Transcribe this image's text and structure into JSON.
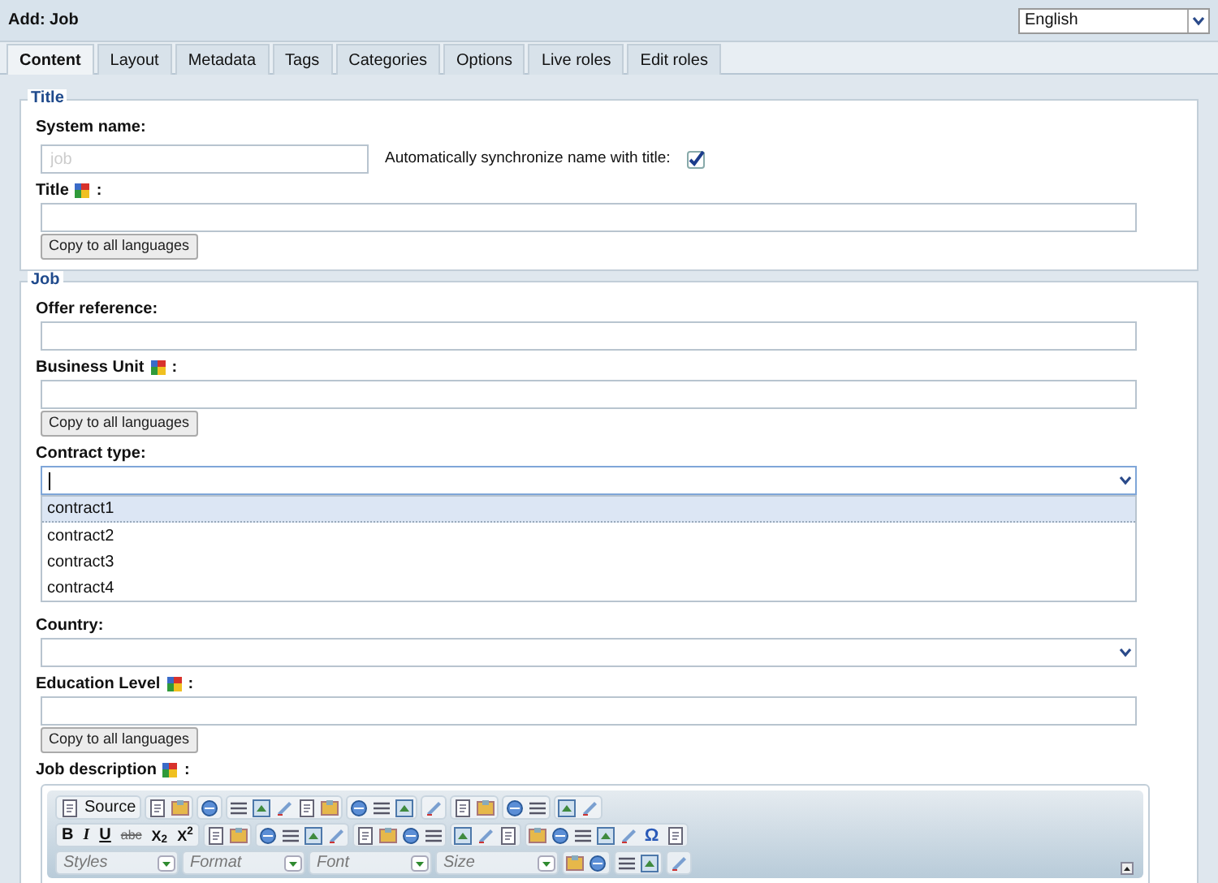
{
  "header": {
    "title": "Add: Job",
    "language": "English"
  },
  "tabs": [
    {
      "label": "Content",
      "selected": true
    },
    {
      "label": "Layout",
      "selected": false
    },
    {
      "label": "Metadata",
      "selected": false
    },
    {
      "label": "Tags",
      "selected": false
    },
    {
      "label": "Categories",
      "selected": false
    },
    {
      "label": "Options",
      "selected": false
    },
    {
      "label": "Live roles",
      "selected": false
    },
    {
      "label": "Edit roles",
      "selected": false
    }
  ],
  "title_section": {
    "legend": "Title",
    "system_name_label": "System name:",
    "system_name_placeholder": "job",
    "sync_label": "Automatically synchronize name with title:",
    "sync_checked": true,
    "title_label": "Title",
    "title_translatable": true,
    "title_colon": ":",
    "copy_button": "Copy to all languages"
  },
  "job_section": {
    "legend": "Job",
    "fields": [
      {
        "kind": "text",
        "label": "Offer reference:",
        "translatable": false
      },
      {
        "kind": "text",
        "label": "Business Unit",
        "translatable": true,
        "colon": ":",
        "copy_button": "Copy to all languages"
      },
      {
        "kind": "combo",
        "label": "Contract type:",
        "translatable": false,
        "expanded": true,
        "options": [
          {
            "label": "contract1",
            "selected": true
          },
          {
            "label": "contract2",
            "selected": false
          },
          {
            "label": "contract3",
            "selected": false
          },
          {
            "label": "contract4",
            "selected": false
          }
        ]
      },
      {
        "kind": "select",
        "label": "Country:",
        "translatable": false
      },
      {
        "kind": "text",
        "label": "Education Level",
        "translatable": true,
        "colon": ":",
        "copy_button": "Copy to all languages"
      },
      {
        "kind": "editor",
        "label": "Job description",
        "translatable": true,
        "colon": ":"
      }
    ]
  },
  "editor": {
    "toolbar_rows": [
      [
        [
          {
            "kind": "source",
            "label": "Source"
          }
        ],
        [
          {
            "kind": "icon"
          },
          {
            "kind": "icon"
          }
        ],
        [
          {
            "kind": "icon"
          }
        ],
        [
          {
            "kind": "icon"
          },
          {
            "kind": "icon"
          },
          {
            "kind": "icon"
          },
          {
            "kind": "icon"
          },
          {
            "kind": "icon"
          }
        ],
        [
          {
            "kind": "icon"
          },
          {
            "kind": "icon"
          },
          {
            "kind": "icon"
          }
        ],
        [
          {
            "kind": "icon"
          }
        ],
        [
          {
            "kind": "icon"
          },
          {
            "kind": "icon"
          }
        ],
        [
          {
            "kind": "icon"
          },
          {
            "kind": "icon"
          }
        ],
        [
          {
            "kind": "icon"
          },
          {
            "kind": "icon"
          }
        ]
      ],
      [
        [
          {
            "kind": "bold",
            "label": "B"
          },
          {
            "kind": "italic",
            "label": "I"
          },
          {
            "kind": "underline",
            "label": "U"
          },
          {
            "kind": "strike",
            "label": "abc"
          },
          {
            "kind": "script",
            "label": "X$_{2}$"
          },
          {
            "kind": "script",
            "label": "X$^{2}$"
          }
        ],
        [
          {
            "kind": "icon"
          },
          {
            "kind": "icon"
          }
        ],
        [
          {
            "kind": "icon"
          },
          {
            "kind": "icon"
          },
          {
            "kind": "icon"
          },
          {
            "kind": "icon"
          }
        ],
        [
          {
            "kind": "icon"
          },
          {
            "kind": "icon"
          },
          {
            "kind": "icon"
          },
          {
            "kind": "icon"
          }
        ],
        [
          {
            "kind": "icon"
          },
          {
            "kind": "icon"
          },
          {
            "kind": "icon"
          }
        ],
        [
          {
            "kind": "icon"
          },
          {
            "kind": "icon"
          },
          {
            "kind": "icon"
          },
          {
            "kind": "icon"
          },
          {
            "kind": "icon"
          },
          {
            "kind": "symbol",
            "label": "Ω"
          },
          {
            "kind": "icon"
          }
        ]
      ],
      [
        [
          {
            "kind": "combo",
            "label": "Styles"
          }
        ],
        [
          {
            "kind": "combo",
            "label": "Format"
          }
        ],
        [
          {
            "kind": "combo",
            "label": "Font"
          }
        ],
        [
          {
            "kind": "combo",
            "label": "Size"
          }
        ],
        [
          {
            "kind": "icon"
          },
          {
            "kind": "icon"
          }
        ],
        [
          {
            "kind": "icon"
          },
          {
            "kind": "icon"
          }
        ],
        [
          {
            "kind": "icon"
          }
        ]
      ]
    ]
  }
}
